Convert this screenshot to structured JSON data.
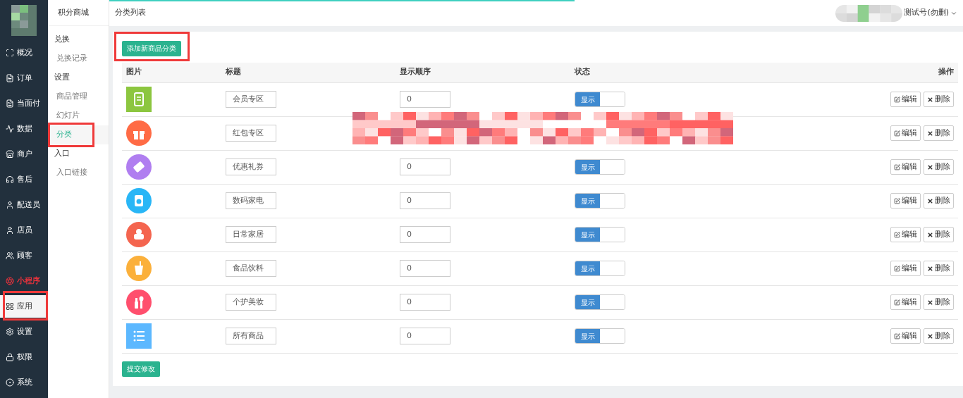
{
  "sidebar": {
    "items": [
      {
        "label": "概况",
        "selected": false,
        "highlighted": false,
        "annotated": false
      },
      {
        "label": "订单",
        "selected": false,
        "highlighted": false,
        "annotated": false
      },
      {
        "label": "当面付",
        "selected": false,
        "highlighted": false,
        "annotated": false
      },
      {
        "label": "数据",
        "selected": false,
        "highlighted": false,
        "annotated": false
      },
      {
        "label": "商户",
        "selected": false,
        "highlighted": false,
        "annotated": false
      },
      {
        "label": "售后",
        "selected": false,
        "highlighted": false,
        "annotated": false
      },
      {
        "label": "配送员",
        "selected": false,
        "highlighted": false,
        "annotated": false
      },
      {
        "label": "店员",
        "selected": false,
        "highlighted": false,
        "annotated": false
      },
      {
        "label": "顾客",
        "selected": false,
        "highlighted": false,
        "annotated": false
      },
      {
        "label": "小程序",
        "selected": false,
        "highlighted": true,
        "annotated": false
      },
      {
        "label": "应用",
        "selected": true,
        "highlighted": false,
        "annotated": true
      },
      {
        "label": "设置",
        "selected": false,
        "highlighted": false,
        "annotated": false
      },
      {
        "label": "权限",
        "selected": false,
        "highlighted": false,
        "annotated": false
      },
      {
        "label": "系统",
        "selected": false,
        "highlighted": false,
        "annotated": false
      }
    ]
  },
  "subnav": {
    "title": "积分商城",
    "groups": [
      {
        "label": "兑换",
        "children": [
          {
            "label": "兑换记录",
            "selected": false,
            "annotated": false
          }
        ]
      },
      {
        "label": "设置",
        "children": [
          {
            "label": "商品管理",
            "selected": false,
            "annotated": false
          },
          {
            "label": "幻灯片",
            "selected": false,
            "annotated": false
          },
          {
            "label": "分类",
            "selected": true,
            "annotated": true
          }
        ]
      },
      {
        "label": "入口",
        "children": [
          {
            "label": "入口链接",
            "selected": false,
            "annotated": false
          }
        ]
      }
    ]
  },
  "header": {
    "title": "分类列表",
    "user": "测试号(勿删)"
  },
  "add_button": {
    "label": "添加新商品分类",
    "annotated": true
  },
  "table": {
    "columns": [
      "图片",
      "标题",
      "显示顺序",
      "状态",
      "操作"
    ],
    "rows": [
      {
        "color": "#8cc63f",
        "kind": "square",
        "title": "会员专区",
        "order": "0",
        "status": {
          "label": "显示",
          "on": true
        },
        "edit": "编辑",
        "delete": "删除"
      },
      {
        "color": "#ff6b45",
        "kind": "circle",
        "title": "红包专区",
        "edit": "编辑",
        "delete": "删除"
      },
      {
        "color": "#b07ef0",
        "kind": "circle",
        "title": "优惠礼券",
        "order": "0",
        "status": {
          "label": "显示",
          "on": true
        },
        "edit": "编辑",
        "delete": "删除"
      },
      {
        "color": "#29b6f6",
        "kind": "circle",
        "title": "数码家电",
        "order": "0",
        "status": {
          "label": "显示",
          "on": true
        },
        "edit": "编辑",
        "delete": "删除"
      },
      {
        "color": "#f4654f",
        "kind": "circle",
        "title": "日常家居",
        "order": "0",
        "status": {
          "label": "显示",
          "on": true
        },
        "edit": "编辑",
        "delete": "删除"
      },
      {
        "color": "#fbb03b",
        "kind": "circle",
        "title": "食品饮料",
        "order": "0",
        "status": {
          "label": "显示",
          "on": true
        },
        "edit": "编辑",
        "delete": "删除"
      },
      {
        "color": "#ff4f6d",
        "kind": "circle",
        "title": "个护美妆",
        "order": "0",
        "status": {
          "label": "显示",
          "on": true
        },
        "edit": "编辑",
        "delete": "删除"
      },
      {
        "color": "#5cb8ff",
        "kind": "square",
        "title": "所有商品",
        "order": "0",
        "status": {
          "label": "显示",
          "on": true
        },
        "edit": "编辑",
        "delete": "删除"
      }
    ]
  },
  "submit_button": {
    "label": "提交修改"
  }
}
